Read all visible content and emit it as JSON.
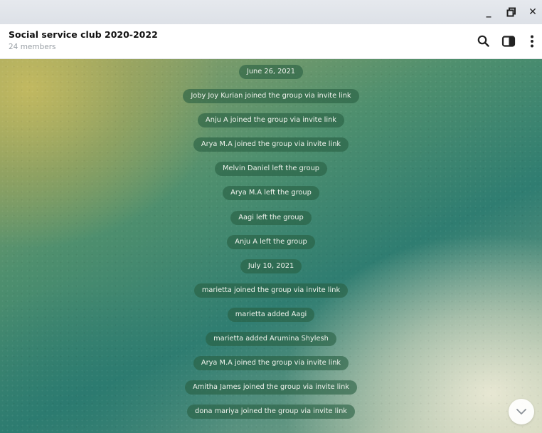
{
  "window": {
    "minimize_label": "_",
    "maximize_label": "⧉",
    "close_label": "✕"
  },
  "header": {
    "title": "Social service club 2020-2022",
    "subtitle": "24 members",
    "icons": [
      "search-icon",
      "sidebar-toggle-icon",
      "more-vertical-icon"
    ]
  },
  "messages": [
    {
      "kind": "date",
      "text": "June 26, 2021"
    },
    {
      "kind": "service",
      "text": "Joby Joy Kurian joined the group via invite link"
    },
    {
      "kind": "service",
      "text": "Anju A joined the group via invite link"
    },
    {
      "kind": "service",
      "text": "Arya M.A joined the group via invite link"
    },
    {
      "kind": "service",
      "text": "Melvin Daniel left the group"
    },
    {
      "kind": "service",
      "text": "Arya M.A left the group"
    },
    {
      "kind": "service",
      "text": "Aagi left the group"
    },
    {
      "kind": "service",
      "text": "Anju A left the group"
    },
    {
      "kind": "date",
      "text": "July 10, 2021"
    },
    {
      "kind": "service",
      "text": "marietta joined the group via invite link"
    },
    {
      "kind": "service",
      "text": "marietta added Aagi"
    },
    {
      "kind": "service",
      "text": "marietta added Arumina Shylesh"
    },
    {
      "kind": "service",
      "text": "Arya M.A joined the group via invite link"
    },
    {
      "kind": "service",
      "text": "Amitha James joined the group via invite link"
    },
    {
      "kind": "service",
      "text": "dona mariya joined the group via invite link"
    }
  ],
  "colors": {
    "pill_bg": "#2e6a49",
    "pill_text": "#f1f4ee",
    "header_bg": "#ffffff",
    "titlebar_bg": "#e2e5ea"
  },
  "scroll_down_icon": "chevron-down-icon"
}
